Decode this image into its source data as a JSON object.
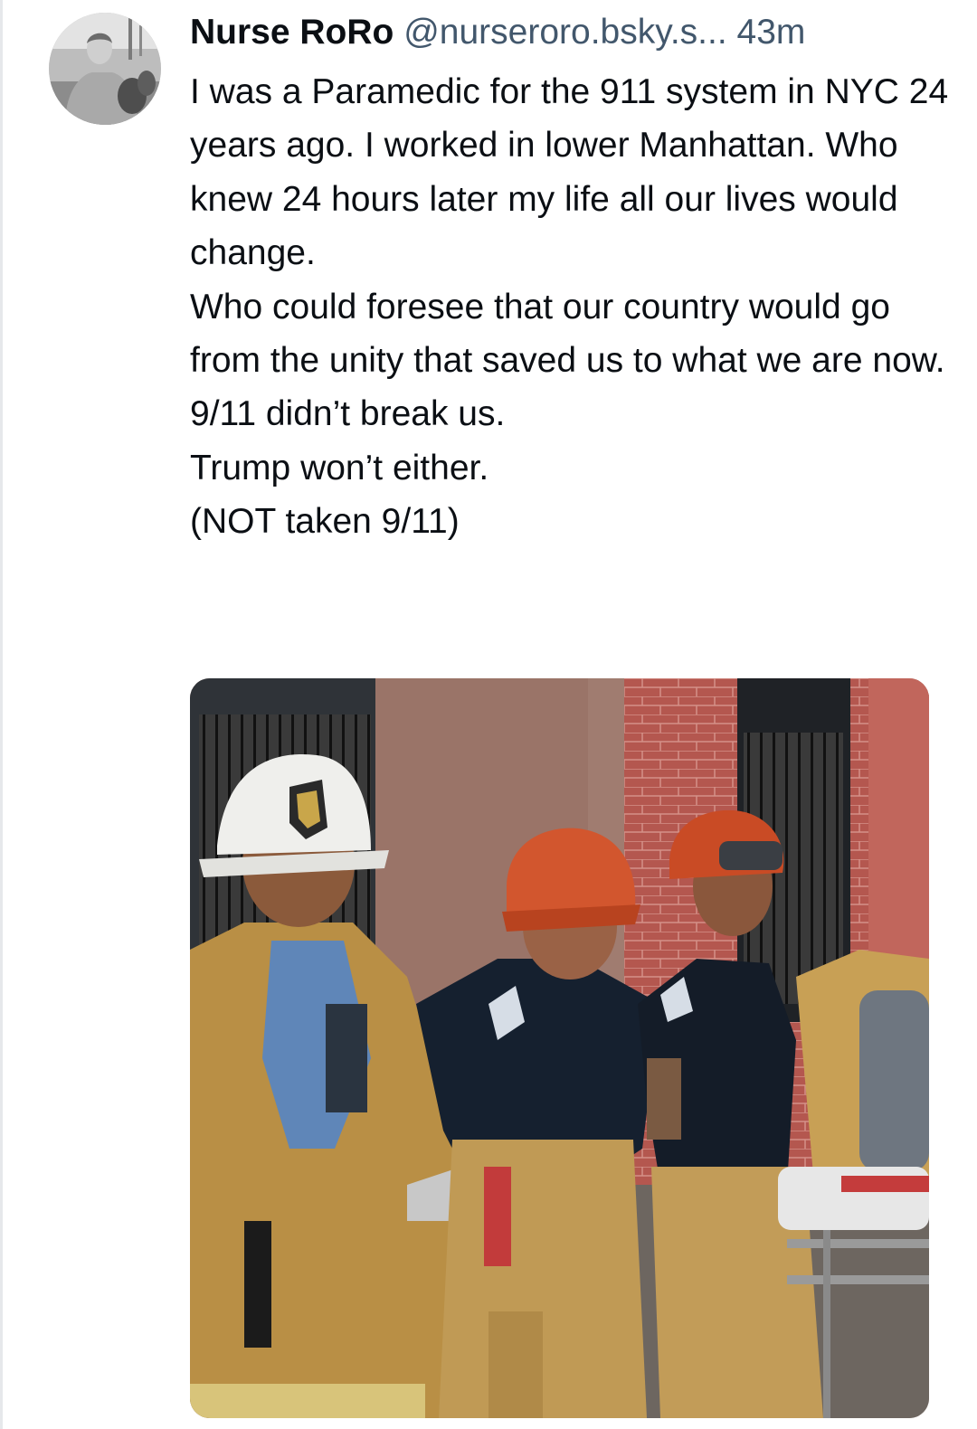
{
  "post": {
    "author": {
      "display_name": "Nurse RoRo",
      "handle": "@nurseroro.bsky.s...",
      "avatar_icon": "profile-photo-avatar"
    },
    "timestamp": "43m",
    "text_paragraphs": [
      "I was a Paramedic for the 911 system in NYC 24 years ago. I worked in lower Manhattan. Who knew 24 hours later my life all our lives would change.",
      "Who could foresee that our country would go from the unity that saved us to what we are now. 9/11 didn’t break us.",
      "Trump won’t either.",
      "(NOT taken 9/11)"
    ],
    "media": {
      "kind": "photo"
    }
  },
  "colors": {
    "text_primary": "#0b0f14",
    "text_secondary": "#42576c",
    "background": "#ffffff",
    "divider": "#e6e8eb"
  }
}
